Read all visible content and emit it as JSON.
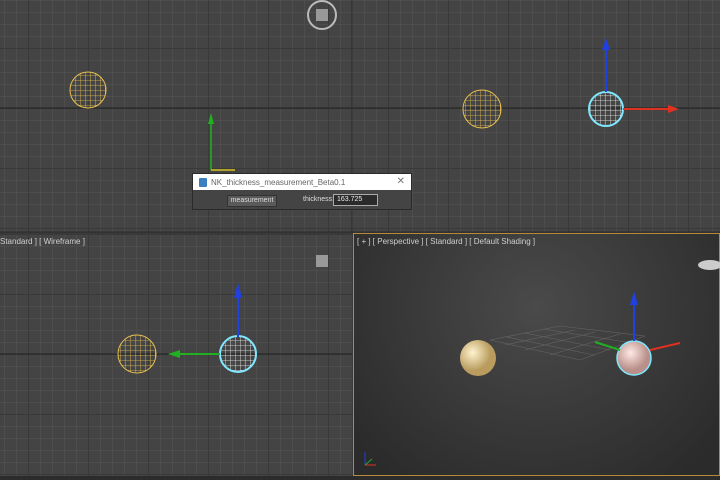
{
  "viewports": {
    "left_label": "Standard ] [ Wireframe ]",
    "perspective_label": "[ + ] [ Perspective ] [ Standard ] [ Default Shading ]"
  },
  "dialog": {
    "title": "NK_thickness_measurement_Beta0.1",
    "close": "✕",
    "button": "measurement",
    "field_label": "thickness:",
    "field_value": "163.725"
  },
  "colors": {
    "wire": "#e8c050",
    "selected": "#7fe8ff",
    "x_axis": "#e03020",
    "y_axis": "#20b020",
    "z_axis": "#2040e0",
    "active_border": "#b58a3a"
  }
}
